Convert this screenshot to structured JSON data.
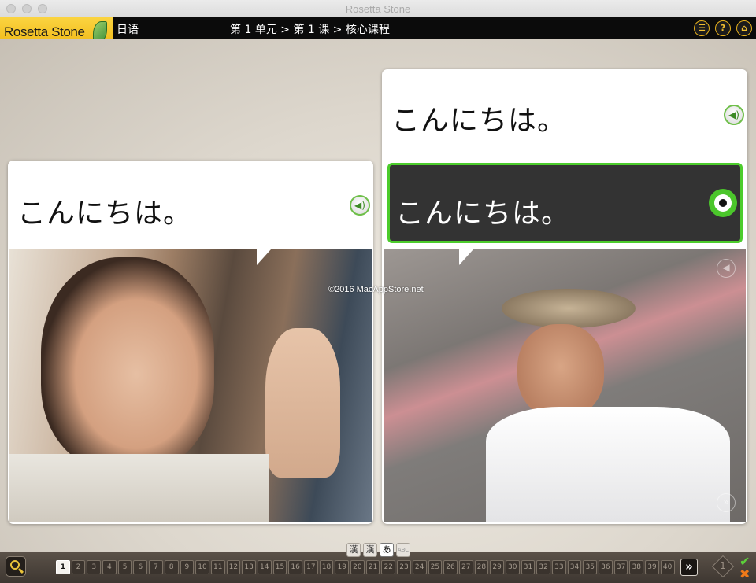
{
  "window": {
    "title": "Rosetta Stone"
  },
  "header": {
    "logo_text": "Rosetta Stone",
    "language": "日语",
    "breadcrumb": "第 1 单元 > 第 1 课 > 核心课程",
    "icons": [
      "menu-icon",
      "help-icon",
      "home-icon"
    ]
  },
  "lesson": {
    "left_card": {
      "phrase": "こんにちは。"
    },
    "right_card": {
      "phrase": "こんにちは。"
    },
    "answer": {
      "phrase": "こんにちは。"
    },
    "watermark": "©2016 MacAppStore.net"
  },
  "footer": {
    "modes": [
      "漢",
      "漢",
      "あ",
      "ABC"
    ],
    "active_mode_index": 2,
    "pages": [
      "1",
      "2",
      "3",
      "4",
      "5",
      "6",
      "7",
      "8",
      "9",
      "10",
      "11",
      "12",
      "13",
      "14",
      "15",
      "16",
      "17",
      "18",
      "19",
      "20",
      "21",
      "22",
      "23",
      "24",
      "25",
      "26",
      "27",
      "28",
      "29",
      "30",
      "31",
      "32",
      "33",
      "34",
      "35",
      "36",
      "37",
      "38",
      "39",
      "40"
    ],
    "current_page": "1",
    "next_label": "»",
    "score_number": "1"
  },
  "colors": {
    "accent_green": "#4ccc2c",
    "logo_yellow": "#f5c42a",
    "incorrect_orange": "#f07a19"
  }
}
